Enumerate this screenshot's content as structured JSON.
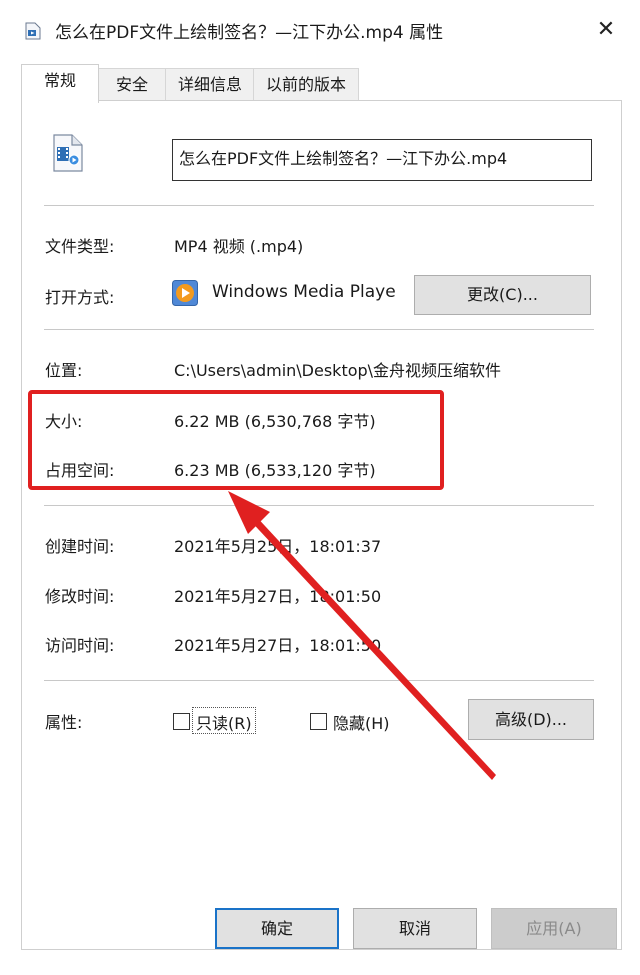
{
  "window": {
    "title": "怎么在PDF文件上绘制签名？—江下办公.mp4 属性",
    "close_glyph": "✕"
  },
  "tabs": [
    {
      "label": "常规",
      "active": true
    },
    {
      "label": "安全",
      "active": false
    },
    {
      "label": "详细信息",
      "active": false
    },
    {
      "label": "以前的版本",
      "active": false
    }
  ],
  "general": {
    "file_name": "怎么在PDF文件上绘制签名？—江下办公.mp4",
    "file_type_label": "文件类型:",
    "file_type_value": "MP4 视频 (.mp4)",
    "open_with_label": "打开方式:",
    "open_with_app": "Windows Media Playe",
    "change_button": "更改(C)...",
    "location_label": "位置:",
    "location_value": "C:\\Users\\admin\\Desktop\\金舟视频压缩软件",
    "size_label": "大小:",
    "size_value": "6.22 MB (6,530,768 字节)",
    "disk_size_label": "占用空间:",
    "disk_size_value": "6.23 MB (6,533,120 字节)",
    "created_label": "创建时间:",
    "created_value": "2021年5月25日，18:01:37",
    "modified_label": "修改时间:",
    "modified_value": "2021年5月27日，18:01:50",
    "accessed_label": "访问时间:",
    "accessed_value": "2021年5月27日，18:01:50",
    "attributes_label": "属性:",
    "readonly_label": "只读(R)",
    "readonly_checked": false,
    "hidden_label": "隐藏(H)",
    "hidden_checked": false,
    "advanced_button": "高级(D)..."
  },
  "footer": {
    "ok_button": "确定",
    "cancel_button": "取消",
    "apply_button": "应用(A)",
    "apply_enabled": false
  },
  "annotation": {
    "highlight_color": "#e02020"
  }
}
